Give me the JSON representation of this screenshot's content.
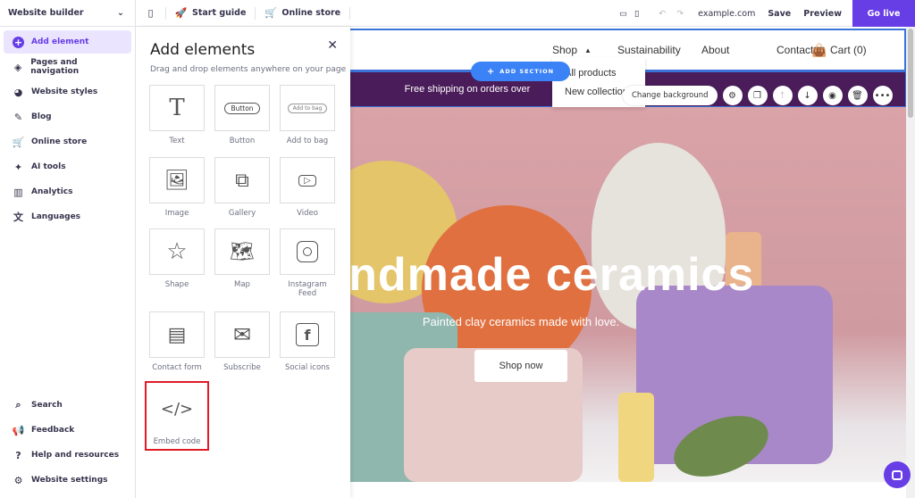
{
  "topbar": {
    "builder": "Website builder",
    "start_guide": "Start guide",
    "online_store": "Online store",
    "domain": "example.com",
    "save": "Save",
    "preview": "Preview",
    "go_live": "Go live"
  },
  "sidebar": {
    "items": [
      {
        "label": "Add element",
        "icon": "plus-circle-icon"
      },
      {
        "label": "Pages and navigation",
        "icon": "layers-icon"
      },
      {
        "label": "Website styles",
        "icon": "palette-icon"
      },
      {
        "label": "Blog",
        "icon": "pen-icon"
      },
      {
        "label": "Online store",
        "icon": "cart-icon"
      },
      {
        "label": "AI tools",
        "icon": "sparkle-icon"
      },
      {
        "label": "Analytics",
        "icon": "bar-chart-icon"
      },
      {
        "label": "Languages",
        "icon": "translate-icon"
      }
    ],
    "bottom": [
      {
        "label": "Search",
        "icon": "search-icon"
      },
      {
        "label": "Feedback",
        "icon": "megaphone-icon"
      },
      {
        "label": "Help and resources",
        "icon": "help-icon"
      },
      {
        "label": "Website settings",
        "icon": "gear-icon"
      }
    ]
  },
  "panel": {
    "title": "Add elements",
    "subtitle": "Drag and drop elements anywhere on your page",
    "tiles": [
      {
        "label": "Text",
        "preview": "T"
      },
      {
        "label": "Button",
        "preview": "Button"
      },
      {
        "label": "Add to bag",
        "preview": "Add to bag"
      },
      {
        "label": "Image"
      },
      {
        "label": "Gallery"
      },
      {
        "label": "Video"
      },
      {
        "label": "Shape"
      },
      {
        "label": "Map"
      },
      {
        "label": "Instagram Feed"
      },
      {
        "label": "Contact form"
      },
      {
        "label": "Subscribe"
      },
      {
        "label": "Social icons"
      },
      {
        "label": "Embed code",
        "preview": "</>"
      }
    ]
  },
  "site": {
    "nav": [
      "Shop",
      "Sustainability",
      "About",
      "Contact"
    ],
    "cart": "Cart (0)",
    "dropdown": [
      "All products",
      "New collection"
    ],
    "banner": "Free shipping on orders over",
    "add_section": "ADD SECTION",
    "change_bg": "Change background",
    "hero_title": "Handmade ceramics",
    "hero_sub": "Painted clay ceramics made with love.",
    "hero_button": "Shop now"
  }
}
